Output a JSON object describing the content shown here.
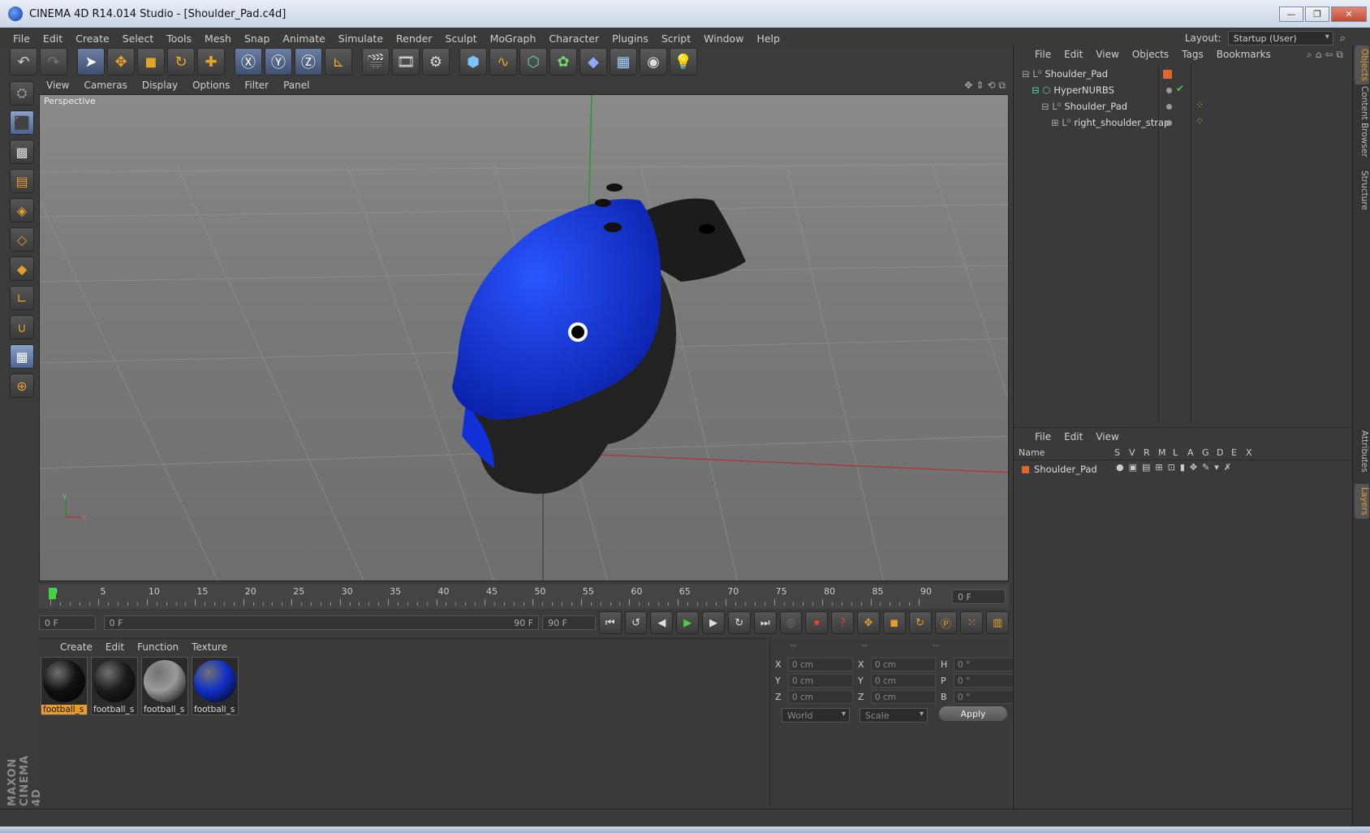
{
  "window": {
    "title": "CINEMA 4D R14.014 Studio - [Shoulder_Pad.c4d]",
    "min": "—",
    "max": "❐",
    "close": "✕"
  },
  "menubar": {
    "items": [
      "File",
      "Edit",
      "Create",
      "Select",
      "Tools",
      "Mesh",
      "Snap",
      "Animate",
      "Simulate",
      "Render",
      "Sculpt",
      "MoGraph",
      "Character",
      "Plugins",
      "Script",
      "Window",
      "Help"
    ]
  },
  "layout": {
    "label": "Layout:",
    "value": "Startup (User)"
  },
  "toolbar": {
    "icons": [
      "undo-icon",
      "redo-icon",
      "select-arrow-icon",
      "move-icon",
      "scale-icon",
      "rotate-icon",
      "add-icon",
      "x-axis-icon",
      "y-axis-icon",
      "z-axis-icon",
      "coord-system-icon",
      "render-view-icon",
      "render-picture-viewer-icon",
      "render-settings-icon",
      "cube-icon",
      "spline-icon",
      "nurbs-icon",
      "array-icon",
      "deformer-icon",
      "floor-icon",
      "camera-icon",
      "light-icon"
    ]
  },
  "viewport": {
    "menu": [
      "View",
      "Cameras",
      "Display",
      "Options",
      "Filter",
      "Panel"
    ],
    "label": "Perspective",
    "axis_y": "Y",
    "axis_x": "X"
  },
  "timeline": {
    "ticks": [
      "0",
      "5",
      "10",
      "15",
      "20",
      "25",
      "30",
      "35",
      "40",
      "45",
      "50",
      "55",
      "60",
      "65",
      "70",
      "75",
      "80",
      "85",
      "90"
    ],
    "current_frame": "0 F"
  },
  "transport": {
    "start_field": "0 F",
    "range_start": "0 F",
    "range_end": "90 F",
    "end_field": "90 F"
  },
  "materials": {
    "menu": [
      "Create",
      "Edit",
      "Function",
      "Texture"
    ],
    "items": [
      {
        "label": "football_s",
        "color": "#111111"
      },
      {
        "label": "football_s",
        "color": "#1c1c1c"
      },
      {
        "label": "football_s",
        "color": "#9a9a9a"
      },
      {
        "label": "football_s",
        "color": "#1030c8"
      }
    ]
  },
  "coords": {
    "headers": [
      "--",
      "--",
      "--"
    ],
    "rows": [
      {
        "l1": "X",
        "v1": "0 cm",
        "l2": "X",
        "v2": "0 cm",
        "l3": "H",
        "v3": "0 °"
      },
      {
        "l1": "Y",
        "v1": "0 cm",
        "l2": "Y",
        "v2": "0 cm",
        "l3": "P",
        "v3": "0 °"
      },
      {
        "l1": "Z",
        "v1": "0 cm",
        "l2": "Z",
        "v2": "0 cm",
        "l3": "B",
        "v3": "0 °"
      }
    ],
    "world": "World",
    "scale": "Scale",
    "apply": "Apply"
  },
  "objects": {
    "menu": [
      "File",
      "Edit",
      "View",
      "Objects",
      "Tags",
      "Bookmarks"
    ],
    "tree": [
      "Shoulder_Pad",
      "HyperNURBS",
      "Shoulder_Pad",
      "right_shoulder_strap"
    ]
  },
  "layers": {
    "menu": [
      "File",
      "Edit",
      "View"
    ],
    "headers": {
      "name": "Name",
      "cols": [
        "S",
        "V",
        "R",
        "M",
        "L",
        "A",
        "G",
        "D",
        "E",
        "X"
      ]
    },
    "rows": [
      "Shoulder_Pad"
    ]
  },
  "vtabs": [
    "Objects",
    "Content Browser",
    "Structure",
    "Attributes",
    "Layers"
  ],
  "brand": "MAXON CINEMA 4D",
  "colors": {
    "accent": "#e69d2c",
    "pad_blue": "#1030d8"
  }
}
